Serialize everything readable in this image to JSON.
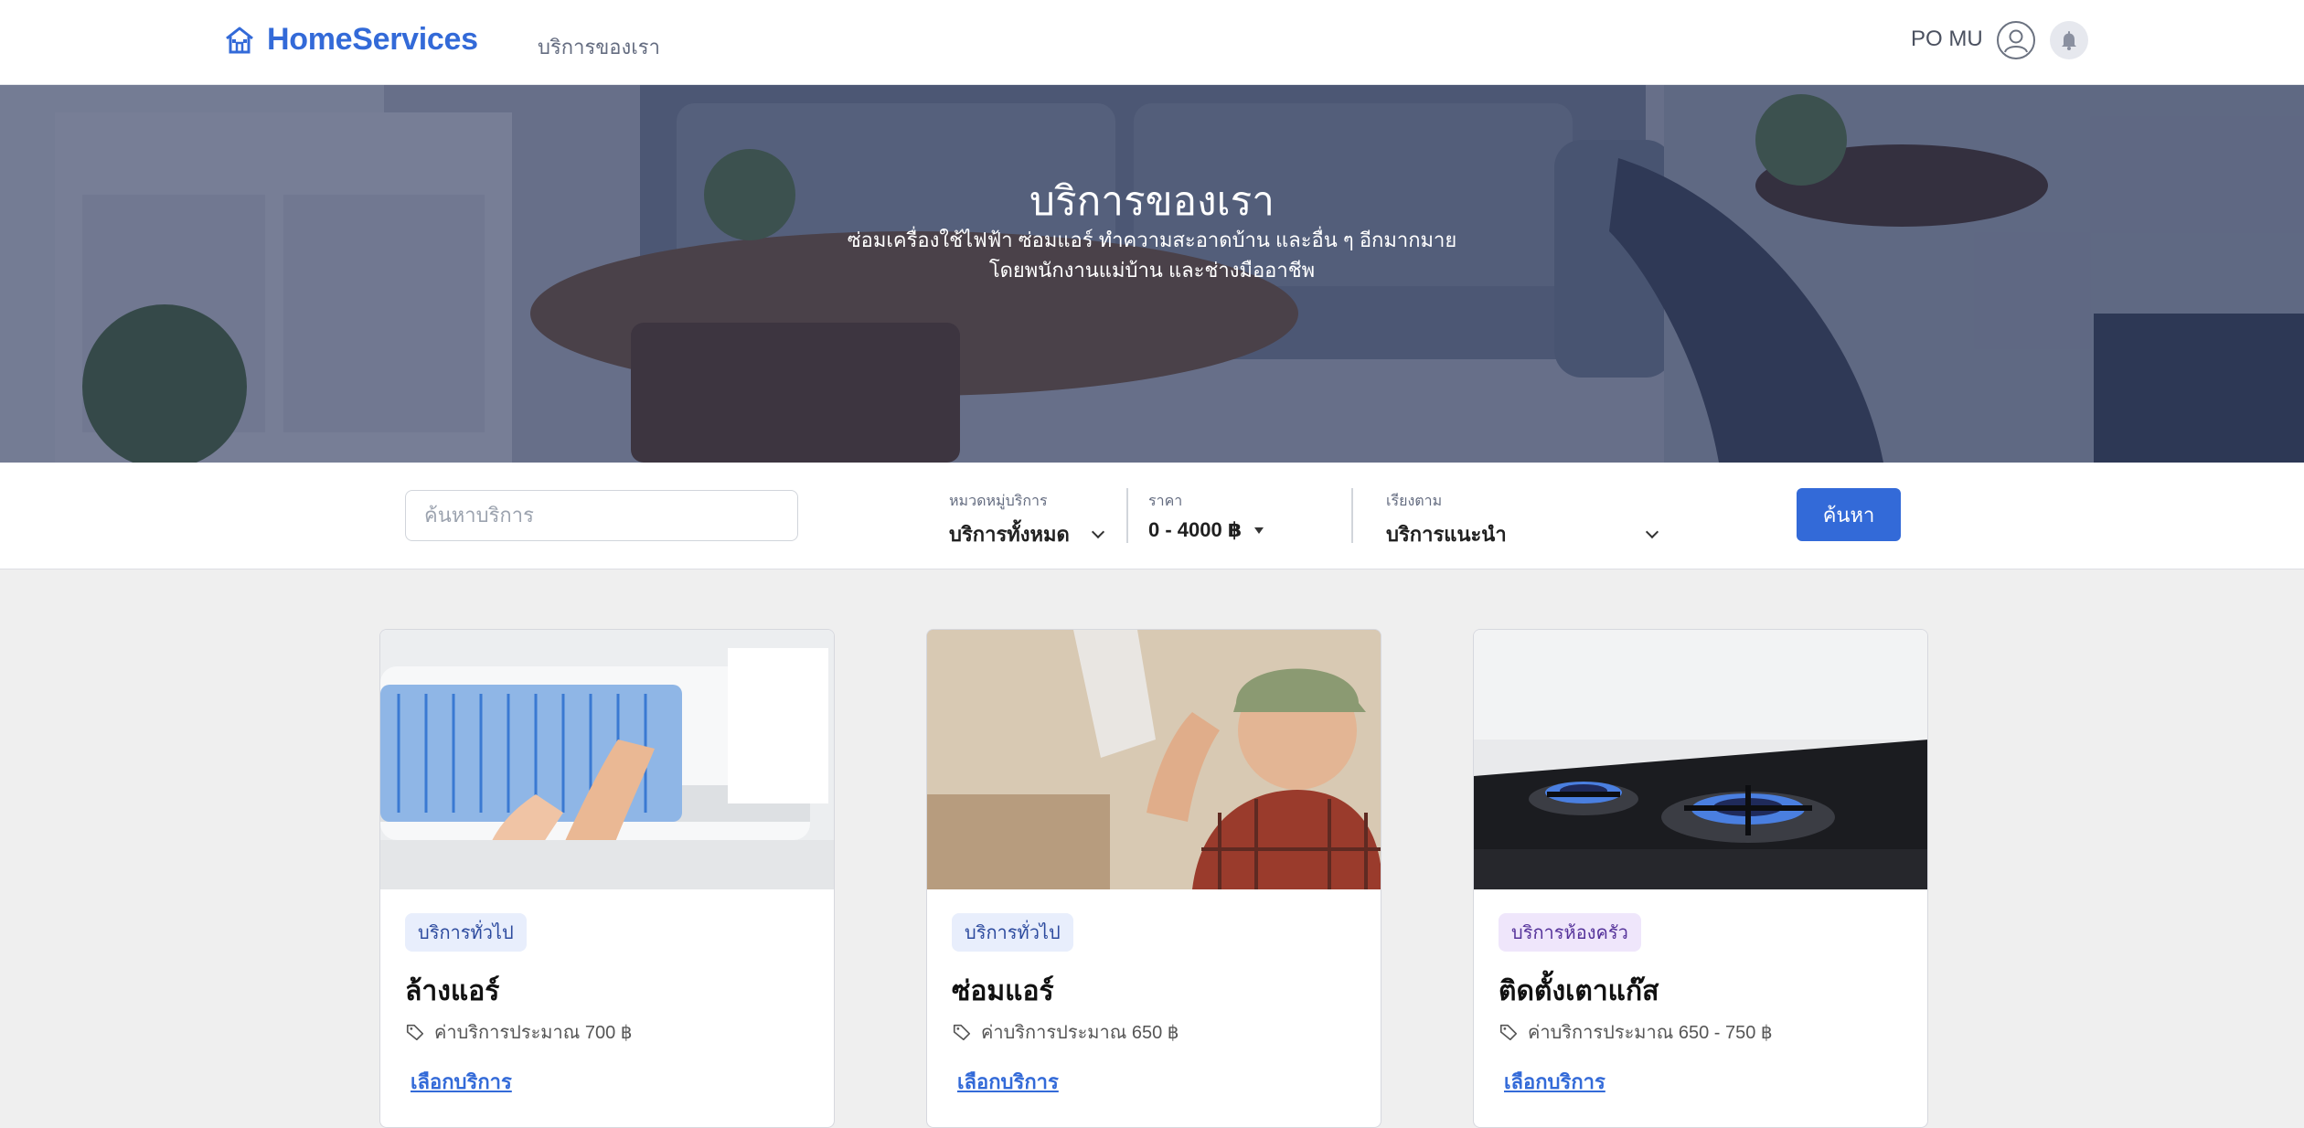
{
  "header": {
    "brand": "HomeServices",
    "nav_services": "บริการของเรา",
    "user_name": "PO MU",
    "icons": {
      "logo": "house-icon",
      "avatar": "user-circle-icon",
      "notifications": "bell-icon"
    }
  },
  "hero": {
    "title": "บริการของเรา",
    "subtitle_line1": "ซ่อมเครื่องใช้ไฟฟ้า ซ่อมแอร์ ทำความสะอาดบ้าน และอื่น ๆ อีกมากมาย",
    "subtitle_line2": "โดยพนักงานแม่บ้าน และช่างมืออาชีพ"
  },
  "filters": {
    "search_placeholder": "ค้นหาบริการ",
    "search_value": "",
    "category": {
      "label": "หมวดหมู่บริการ",
      "value": "บริการทั้งหมด"
    },
    "price": {
      "label": "ราคา",
      "value": "0 - 4000 ฿"
    },
    "sort": {
      "label": "เรียงตาม",
      "value": "บริการแนะนำ"
    },
    "search_button": "ค้นหา"
  },
  "cards": [
    {
      "badge": "บริการทั่วไป",
      "badge_type": "general",
      "title": "ล้างแอร์",
      "price": "ค่าบริการประมาณ 700 ฿",
      "action": "เลือกบริการ"
    },
    {
      "badge": "บริการทั่วไป",
      "badge_type": "general",
      "title": "ซ่อมแอร์",
      "price": "ค่าบริการประมาณ 650 ฿",
      "action": "เลือกบริการ"
    },
    {
      "badge": "บริการห้องครัว",
      "badge_type": "kitchen",
      "title": "ติดตั้งเตาแก๊ส",
      "price": "ค่าบริการประมาณ 650 - 750 ฿",
      "action": "เลือกบริการ"
    }
  ],
  "colors": {
    "primary": "#336ad8",
    "page_bg": "#efefef",
    "general_badge_bg": "#e8eefc",
    "kitchen_badge_bg": "#efe6fb"
  }
}
